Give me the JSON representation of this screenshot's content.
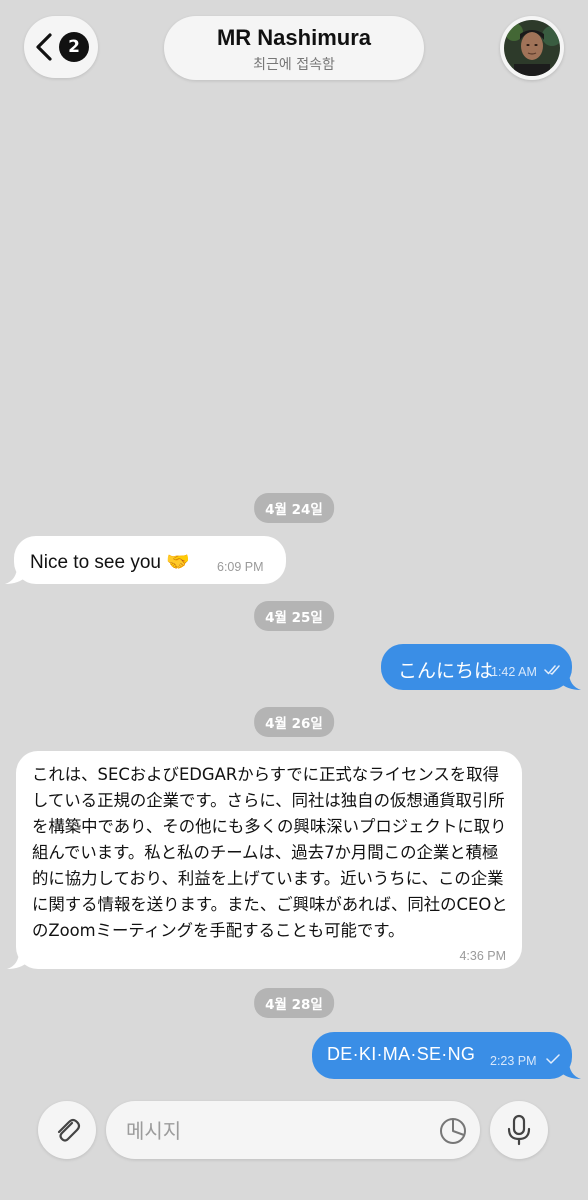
{
  "header": {
    "back_badge": "2",
    "contact_name": "MR Nashimura",
    "status": "최근에 접속함",
    "avatar_icon": "contact-avatar"
  },
  "chat": {
    "groups": [
      {
        "date": "4월 24일",
        "messages": [
          {
            "direction": "in",
            "text": "Nice to see you 🤝",
            "time": "6:09 PM"
          }
        ]
      },
      {
        "date": "4월 25일",
        "messages": [
          {
            "direction": "out",
            "text": "こんにちは",
            "time": "1:42 AM",
            "status": "read"
          }
        ]
      },
      {
        "date": "4월 26일",
        "messages": [
          {
            "direction": "in",
            "text": "これは、SECおよびEDGARからすでに正式なライセンスを取得している正規の企業です。さらに、同社は独自の仮想通貨取引所を構築中であり、その他にも多くの興味深いプロジェクトに取り組んでいます。私と私のチームは、過去7か月間この企業と積極的に協力しており、利益を上げています。近いうちに、この企業に関する情報を送ります。また、ご興味があれば、同社のCEOとのZoomミーティングを手配することも可能です。",
            "time": "4:36 PM"
          }
        ]
      },
      {
        "date": "4월 28일",
        "messages": [
          {
            "direction": "out",
            "text": "DE·KI·MA·SE·NG",
            "time": "2:23 PM",
            "status": "delivered"
          }
        ]
      }
    ]
  },
  "composer": {
    "placeholder": "메시지",
    "value": "",
    "attach_icon": "paperclip-icon",
    "sticker_icon": "sticker-icon",
    "mic_icon": "microphone-icon"
  },
  "colors": {
    "background": "#d9d9d9",
    "incoming_bubble": "#ffffff",
    "outgoing_bubble": "#3a8ee6",
    "date_chip": "#b4b4b4"
  }
}
